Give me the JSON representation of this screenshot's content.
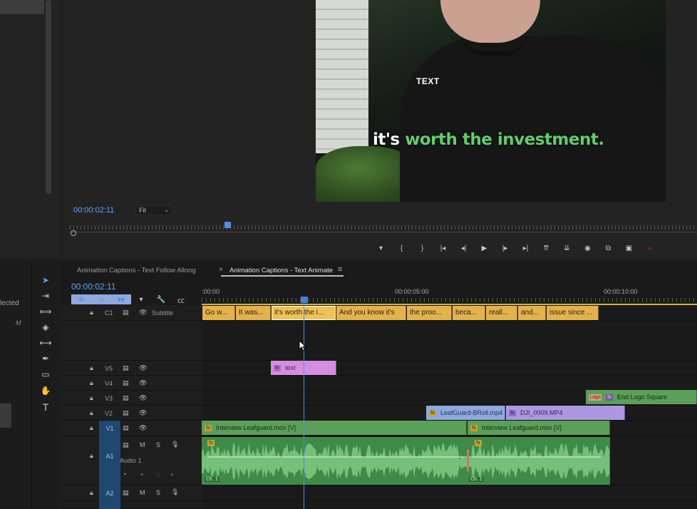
{
  "left_panel": {
    "selected_label": "lected",
    "m_label": "M"
  },
  "program_monitor": {
    "timecode": "00:00:02:11",
    "fit": "Fit",
    "caption_small": "TEXT",
    "caption_main_prefix": "it's ",
    "caption_main_highlight": "worth the investment."
  },
  "transport": {
    "buttons": [
      "marker-icon",
      "mark-in-icon",
      "mark-out-icon",
      "go-to-in-icon",
      "step-back-icon",
      "play-icon",
      "step-forward-icon",
      "go-to-out-icon",
      "lift-icon",
      "extract-icon",
      "export-frame-icon",
      "comparison-icon",
      "proxy-icon",
      "record-icon"
    ],
    "glyphs": [
      "▾",
      "{",
      "}",
      "|◂",
      "◂|",
      "▶",
      "|▸",
      "▸|",
      "⇈",
      "⇊",
      "◉",
      "⧉",
      "▣",
      "●"
    ]
  },
  "timeline": {
    "tabs": [
      {
        "label": "Animation Captions - Text Follow Allong"
      },
      {
        "label": "Animation Captions - Text Animate"
      }
    ],
    "close_glyph": "×",
    "menu_glyph": "≡",
    "timecode": "00:00:02:11",
    "ruler_labels": [
      ":00:00",
      "00:00:05:00",
      "00:00:10:00"
    ],
    "tracks": {
      "c1": {
        "label": "C1",
        "name": "Subtitle"
      },
      "v5": {
        "label": "V5"
      },
      "v4": {
        "label": "V4"
      },
      "v3": {
        "label": "V3"
      },
      "v2": {
        "label": "V2"
      },
      "v1": {
        "label": "V1"
      },
      "a1": {
        "label": "A1",
        "name": "Audio 1",
        "m": "M",
        "s": "S"
      },
      "a2": {
        "label": "A2",
        "m": "M",
        "s": "S"
      }
    },
    "subtitles": [
      "Go w...",
      "It was...",
      "it's worth the i...",
      "And you know it's",
      "the proo...",
      "beca...",
      "reall...",
      "and...",
      "issue since ..."
    ],
    "clips": {
      "text": "text",
      "end_logo": "End Logo Square",
      "logo_badge": "Logo",
      "leafguard_broll": "LeafGuard-BRoll.mp4",
      "dji": "DJI_0009.MP4",
      "interview_1": "Interview Leafguard.mov [V]",
      "interview_2": "Interview Leafguard.mov [V]",
      "fx": "fx"
    },
    "audio_badges": [
      "Ch. 1",
      "Ch. 1"
    ]
  },
  "colors": {
    "accent_blue": "#4a8fe8",
    "caption_green": "#5fd06a",
    "subtitle_clip": "#e3b24b",
    "video_clip": "#5aa058"
  }
}
